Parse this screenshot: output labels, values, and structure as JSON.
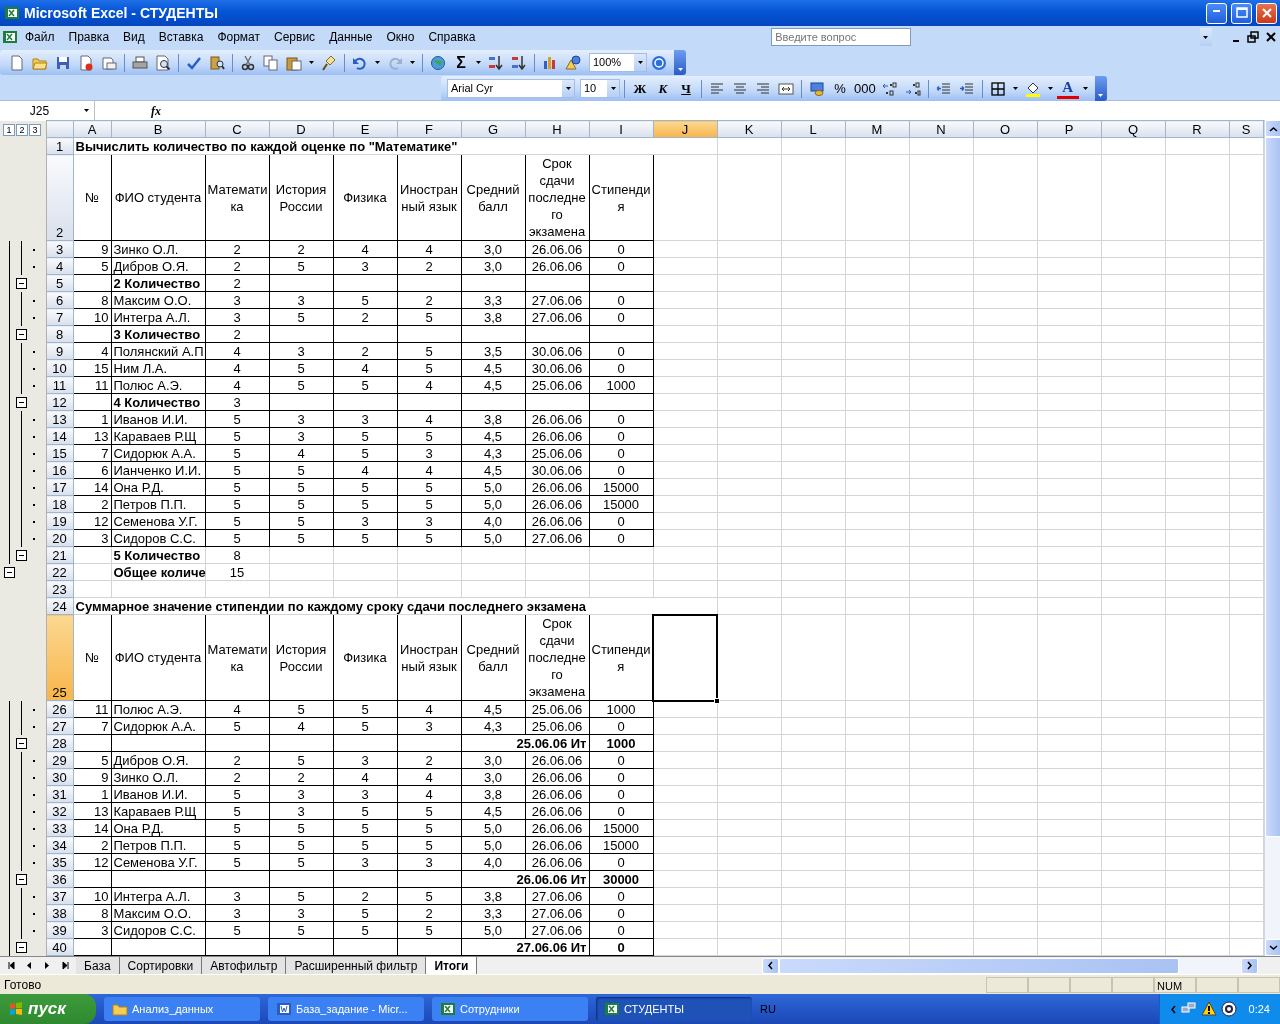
{
  "window": {
    "title": "Microsoft Excel - СТУДЕНТЫ"
  },
  "menu": [
    "Файл",
    "Правка",
    "Вид",
    "Вставка",
    "Формат",
    "Сервис",
    "Данные",
    "Окно",
    "Справка"
  ],
  "ask_field": {
    "placeholder": "Введите вопрос"
  },
  "standard_toolbar": {
    "sum": "Σ",
    "zoom": "100%"
  },
  "format_toolbar": {
    "font": "Arial Cyr",
    "size": "10",
    "style_buttons": [
      "Ж",
      "К",
      "Ч"
    ],
    "number_buttons": [
      "%",
      "000"
    ],
    "font_color": "A"
  },
  "formula_bar": {
    "name_box": "J25",
    "function_label": "fx"
  },
  "outline_levels": [
    "1",
    "2",
    "3"
  ],
  "columns": [
    {
      "label": "A",
      "selected": false
    },
    {
      "label": "B",
      "selected": false
    },
    {
      "label": "C",
      "selected": false
    },
    {
      "label": "D",
      "selected": false
    },
    {
      "label": "E",
      "selected": false
    },
    {
      "label": "F",
      "selected": false
    },
    {
      "label": "G",
      "selected": false
    },
    {
      "label": "H",
      "selected": false
    },
    {
      "label": "I",
      "selected": false
    },
    {
      "label": "J",
      "selected": true
    },
    {
      "label": "K",
      "selected": false
    },
    {
      "label": "L",
      "selected": false
    },
    {
      "label": "M",
      "selected": false
    },
    {
      "label": "N",
      "selected": false
    },
    {
      "label": "O",
      "selected": false
    },
    {
      "label": "P",
      "selected": false
    },
    {
      "label": "Q",
      "selected": false
    },
    {
      "label": "R",
      "selected": false
    },
    {
      "label": "S",
      "selected": false
    }
  ],
  "rows": [
    {
      "n": "1",
      "kind": "title",
      "selected": false,
      "text": "Вычислить количество по каждой оценке по \"Математике\""
    },
    {
      "n": "2",
      "kind": "header",
      "selected": false,
      "cells": [
        "№",
        "ФИО студента",
        "Математи\nка",
        "История\nРоссии",
        "Физика",
        "Иностран\nный язык",
        "Средний\nбалл",
        "Срок\nсдачи\nпоследне\nго\nэкзамена",
        "Стипенди\nя"
      ]
    },
    {
      "n": "3",
      "kind": "data",
      "selected": false,
      "cells": [
        "9",
        "Зинко О.Л.",
        "2",
        "2",
        "4",
        "4",
        "3,0",
        "26.06.06",
        "0"
      ]
    },
    {
      "n": "4",
      "kind": "data",
      "selected": false,
      "cells": [
        "5",
        "Дибров О.Я.",
        "2",
        "5",
        "3",
        "2",
        "3,0",
        "26.06.06",
        "0"
      ]
    },
    {
      "n": "5",
      "kind": "count",
      "selected": false,
      "bordered": true,
      "label": "2 Количество",
      "value": "2"
    },
    {
      "n": "6",
      "kind": "data",
      "selected": false,
      "cells": [
        "8",
        "Максим О.О.",
        "3",
        "3",
        "5",
        "2",
        "3,3",
        "27.06.06",
        "0"
      ]
    },
    {
      "n": "7",
      "kind": "data",
      "selected": false,
      "cells": [
        "10",
        "Интегра А.Л.",
        "3",
        "5",
        "2",
        "5",
        "3,8",
        "27.06.06",
        "0"
      ]
    },
    {
      "n": "8",
      "kind": "count",
      "selected": false,
      "bordered": true,
      "label": "3 Количество",
      "value": "2"
    },
    {
      "n": "9",
      "kind": "data",
      "selected": false,
      "cells": [
        "4",
        "Полянский А.П",
        "4",
        "3",
        "2",
        "5",
        "3,5",
        "30.06.06",
        "0"
      ]
    },
    {
      "n": "10",
      "kind": "data",
      "selected": false,
      "cells": [
        "15",
        "Ним Л.А.",
        "4",
        "5",
        "4",
        "5",
        "4,5",
        "30.06.06",
        "0"
      ]
    },
    {
      "n": "11",
      "kind": "data",
      "selected": false,
      "cells": [
        "11",
        "Полюс А.Э.",
        "4",
        "5",
        "5",
        "4",
        "4,5",
        "25.06.06",
        "1000"
      ]
    },
    {
      "n": "12",
      "kind": "count",
      "selected": false,
      "bordered": true,
      "label": "4 Количество",
      "value": "3"
    },
    {
      "n": "13",
      "kind": "data",
      "selected": false,
      "cells": [
        "1",
        "Иванов И.И.",
        "5",
        "3",
        "3",
        "4",
        "3,8",
        "26.06.06",
        "0"
      ]
    },
    {
      "n": "14",
      "kind": "data",
      "selected": false,
      "cells": [
        "13",
        "Караваев Р.Щ",
        "5",
        "3",
        "5",
        "5",
        "4,5",
        "26.06.06",
        "0"
      ]
    },
    {
      "n": "15",
      "kind": "data",
      "selected": false,
      "cells": [
        "7",
        "Сидорюк А.А.",
        "5",
        "4",
        "5",
        "3",
        "4,3",
        "25.06.06",
        "0"
      ]
    },
    {
      "n": "16",
      "kind": "data",
      "selected": false,
      "cells": [
        "6",
        "Ианченко И.И.",
        "5",
        "5",
        "4",
        "4",
        "4,5",
        "30.06.06",
        "0"
      ]
    },
    {
      "n": "17",
      "kind": "data",
      "selected": false,
      "cells": [
        "14",
        "Она Р.Д.",
        "5",
        "5",
        "5",
        "5",
        "5,0",
        "26.06.06",
        "15000"
      ]
    },
    {
      "n": "18",
      "kind": "data",
      "selected": false,
      "cells": [
        "2",
        "Петров П.П.",
        "5",
        "5",
        "5",
        "5",
        "5,0",
        "26.06.06",
        "15000"
      ]
    },
    {
      "n": "19",
      "kind": "data",
      "selected": false,
      "cells": [
        "12",
        "Семенова У.Г.",
        "5",
        "5",
        "3",
        "3",
        "4,0",
        "26.06.06",
        "0"
      ]
    },
    {
      "n": "20",
      "kind": "data",
      "selected": false,
      "cells": [
        "3",
        "Сидоров С.С.",
        "5",
        "5",
        "5",
        "5",
        "5,0",
        "27.06.06",
        "0"
      ]
    },
    {
      "n": "21",
      "kind": "count",
      "selected": false,
      "bordered": false,
      "label": "5 Количество",
      "value": "8"
    },
    {
      "n": "22",
      "kind": "grand",
      "selected": false,
      "label": "Общее количе",
      "value": "15"
    },
    {
      "n": "23",
      "kind": "blank",
      "selected": false
    },
    {
      "n": "24",
      "kind": "title",
      "selected": false,
      "text": "Суммарное значение стипендии по каждому сроку сдачи последнего экзамена"
    },
    {
      "n": "25",
      "kind": "header",
      "selected": true,
      "cells": [
        "№",
        "ФИО студента",
        "Математи\nка",
        "История\nРоссии",
        "Физика",
        "Иностран\nный язык",
        "Средний\nбалл",
        "Срок\nсдачи\nпоследне\nго\nэкзамена",
        "Стипенди\nя"
      ]
    },
    {
      "n": "26",
      "kind": "data",
      "selected": false,
      "cells": [
        "11",
        "Полюс А.Э.",
        "4",
        "5",
        "5",
        "4",
        "4,5",
        "25.06.06",
        "1000"
      ]
    },
    {
      "n": "27",
      "kind": "data",
      "selected": false,
      "cells": [
        "7",
        "Сидорюк А.А.",
        "5",
        "4",
        "5",
        "3",
        "4,3",
        "25.06.06",
        "0"
      ]
    },
    {
      "n": "28",
      "kind": "total",
      "selected": false,
      "label": "25.06.06 Ит",
      "value": "1000"
    },
    {
      "n": "29",
      "kind": "data",
      "selected": false,
      "cells": [
        "5",
        "Дибров О.Я.",
        "2",
        "5",
        "3",
        "2",
        "3,0",
        "26.06.06",
        "0"
      ]
    },
    {
      "n": "30",
      "kind": "data",
      "selected": false,
      "cells": [
        "9",
        "Зинко О.Л.",
        "2",
        "2",
        "4",
        "4",
        "3,0",
        "26.06.06",
        "0"
      ]
    },
    {
      "n": "31",
      "kind": "data",
      "selected": false,
      "cells": [
        "1",
        "Иванов И.И.",
        "5",
        "3",
        "3",
        "4",
        "3,8",
        "26.06.06",
        "0"
      ]
    },
    {
      "n": "32",
      "kind": "data",
      "selected": false,
      "cells": [
        "13",
        "Караваев Р.Щ",
        "5",
        "3",
        "5",
        "5",
        "4,5",
        "26.06.06",
        "0"
      ]
    },
    {
      "n": "33",
      "kind": "data",
      "selected": false,
      "cells": [
        "14",
        "Она Р.Д.",
        "5",
        "5",
        "5",
        "5",
        "5,0",
        "26.06.06",
        "15000"
      ]
    },
    {
      "n": "34",
      "kind": "data",
      "selected": false,
      "cells": [
        "2",
        "Петров П.П.",
        "5",
        "5",
        "5",
        "5",
        "5,0",
        "26.06.06",
        "15000"
      ]
    },
    {
      "n": "35",
      "kind": "data",
      "selected": false,
      "cells": [
        "12",
        "Семенова У.Г.",
        "5",
        "5",
        "3",
        "3",
        "4,0",
        "26.06.06",
        "0"
      ]
    },
    {
      "n": "36",
      "kind": "total",
      "selected": false,
      "label": "26.06.06 Ит",
      "value": "30000"
    },
    {
      "n": "37",
      "kind": "data",
      "selected": false,
      "cells": [
        "10",
        "Интегра А.Л.",
        "3",
        "5",
        "2",
        "5",
        "3,8",
        "27.06.06",
        "0"
      ]
    },
    {
      "n": "38",
      "kind": "data",
      "selected": false,
      "cells": [
        "8",
        "Максим О.О.",
        "3",
        "3",
        "5",
        "2",
        "3,3",
        "27.06.06",
        "0"
      ]
    },
    {
      "n": "39",
      "kind": "data",
      "selected": false,
      "cells": [
        "3",
        "Сидоров С.С.",
        "5",
        "5",
        "5",
        "5",
        "5,0",
        "27.06.06",
        "0"
      ]
    },
    {
      "n": "40",
      "kind": "total",
      "selected": false,
      "label": "27.06.06 Ит",
      "value": "0"
    }
  ],
  "sheet_tabs": [
    {
      "label": "База",
      "selected": false
    },
    {
      "label": "Сортировки",
      "selected": false
    },
    {
      "label": "Автофильтр",
      "selected": false
    },
    {
      "label": "Расширенный фильтр",
      "selected": false
    },
    {
      "label": "Итоги",
      "selected": true
    }
  ],
  "status_bar": {
    "text": "Готово",
    "indicator": "NUM"
  },
  "taskbar": {
    "start": "пуск",
    "items": [
      {
        "label": "Анализ_данных",
        "kind": "folder",
        "selected": false
      },
      {
        "label": "База_задание - Micr...",
        "kind": "word",
        "selected": false
      },
      {
        "label": "Сотрудники",
        "kind": "excel",
        "selected": false
      },
      {
        "label": "СТУДЕНТЫ",
        "kind": "excel",
        "selected": true
      }
    ],
    "language": "RU",
    "clock": "0:24"
  }
}
